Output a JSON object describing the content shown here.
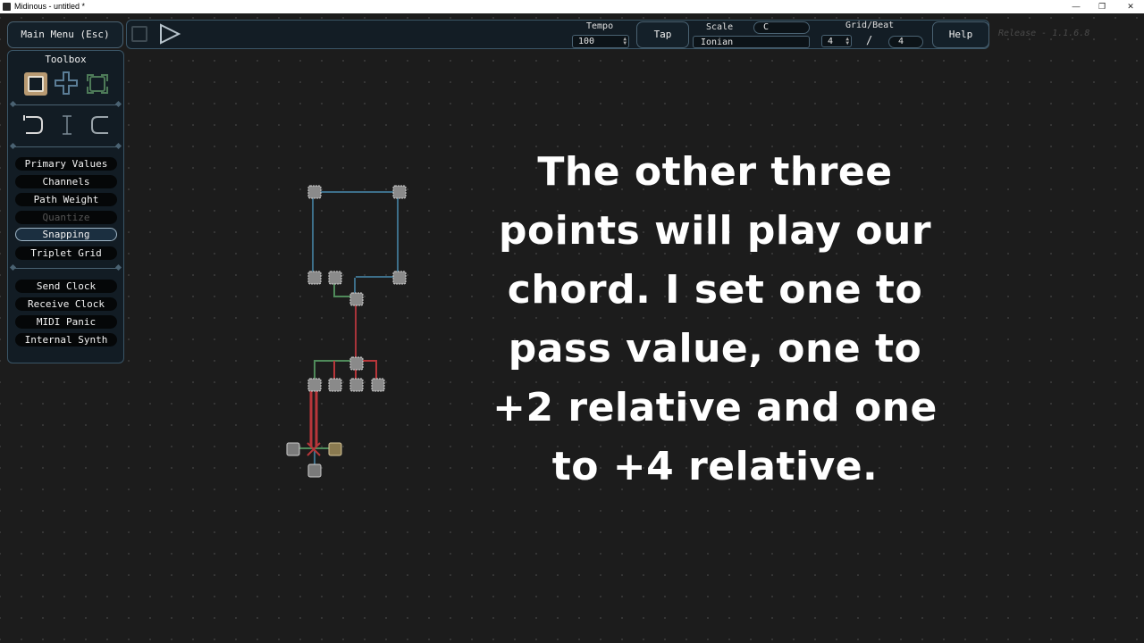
{
  "window": {
    "title": "Midinous - untitled *",
    "minimize": "—",
    "maximize": "❐",
    "close": "✕"
  },
  "toolbar": {
    "main_menu_label": "Main Menu (Esc)",
    "tempo_label": "Tempo",
    "tempo_value": "100",
    "tap_label": "Tap",
    "scale_label": "Scale",
    "scale_key": "C",
    "scale_mode": "Ionian",
    "grid_beat_label": "Grid/Beat",
    "grid_value": "4",
    "grid_separator": "/",
    "beat_value": "4",
    "help_label": "Help",
    "release_text": "Release - 1.1.6.8"
  },
  "toolbox": {
    "title": "Toolbox",
    "mode_icons": [
      "select-tool-icon",
      "add-point-tool-icon",
      "edit-tool-icon"
    ],
    "path_icons": [
      "curve-left-icon",
      "straight-path-icon",
      "curve-right-icon"
    ],
    "group1": [
      {
        "label": "Primary Values",
        "state": "normal"
      },
      {
        "label": "Channels",
        "state": "normal"
      },
      {
        "label": "Path Weight",
        "state": "normal"
      },
      {
        "label": "Quantize",
        "state": "disabled"
      },
      {
        "label": "Snapping",
        "state": "active"
      },
      {
        "label": "Triplet Grid",
        "state": "normal"
      }
    ],
    "group2": [
      {
        "label": "Send Clock"
      },
      {
        "label": "Receive Clock"
      },
      {
        "label": "MIDI Panic"
      },
      {
        "label": "Internal Synth"
      }
    ]
  },
  "caption": {
    "lines": [
      "The other three",
      "points will play our",
      "chord. I set one to",
      "pass value, one to",
      "+2 relative and one",
      "to +4 relative."
    ]
  },
  "colors": {
    "path_blue": "#3d6f8a",
    "path_green": "#4f8a5a",
    "path_red": "#b8363a",
    "node_fill": "#7a7a7a"
  }
}
